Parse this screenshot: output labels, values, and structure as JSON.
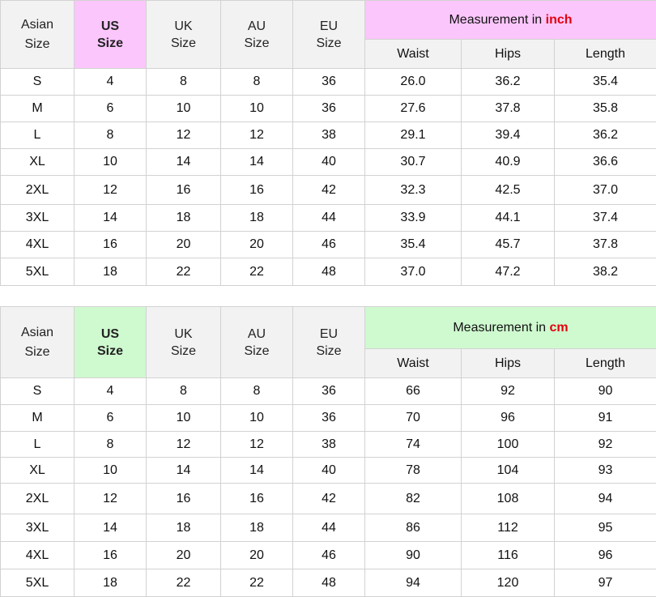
{
  "inch_table": {
    "headers": {
      "asian": [
        "Asian",
        "Size"
      ],
      "us": [
        "US",
        "Size"
      ],
      "uk": [
        "UK",
        "Size"
      ],
      "au": [
        "AU",
        "Size"
      ],
      "eu": [
        "EU",
        "Size"
      ],
      "measurement_prefix": "Measurement in",
      "measurement_unit": "inch",
      "waist": "Waist",
      "hips": "Hips",
      "length": "Length"
    },
    "rows": [
      [
        "S",
        "4",
        "8",
        "8",
        "36",
        "26.0",
        "36.2",
        "35.4"
      ],
      [
        "M",
        "6",
        "10",
        "10",
        "36",
        "27.6",
        "37.8",
        "35.8"
      ],
      [
        "L",
        "8",
        "12",
        "12",
        "38",
        "29.1",
        "39.4",
        "36.2"
      ],
      [
        "XL",
        "10",
        "14",
        "14",
        "40",
        "30.7",
        "40.9",
        "36.6"
      ],
      [
        "2XL",
        "12",
        "16",
        "16",
        "42",
        "32.3",
        "42.5",
        "37.0"
      ],
      [
        "3XL",
        "14",
        "18",
        "18",
        "44",
        "33.9",
        "44.1",
        "37.4"
      ],
      [
        "4XL",
        "16",
        "20",
        "20",
        "46",
        "35.4",
        "45.7",
        "37.8"
      ],
      [
        "5XL",
        "18",
        "22",
        "22",
        "48",
        "37.0",
        "47.2",
        "38.2"
      ]
    ]
  },
  "cm_table": {
    "headers": {
      "asian": [
        "Asian",
        "Size"
      ],
      "us": [
        "US",
        "Size"
      ],
      "uk": [
        "UK",
        "Size"
      ],
      "au": [
        "AU",
        "Size"
      ],
      "eu": [
        "EU",
        "Size"
      ],
      "measurement_prefix": "Measurement in",
      "measurement_unit": "cm",
      "waist": "Waist",
      "hips": "Hips",
      "length": "Length"
    },
    "rows": [
      [
        "S",
        "4",
        "8",
        "8",
        "36",
        "66",
        "92",
        "90"
      ],
      [
        "M",
        "6",
        "10",
        "10",
        "36",
        "70",
        "96",
        "91"
      ],
      [
        "L",
        "8",
        "12",
        "12",
        "38",
        "74",
        "100",
        "92"
      ],
      [
        "XL",
        "10",
        "14",
        "14",
        "40",
        "78",
        "104",
        "93"
      ],
      [
        "2XL",
        "12",
        "16",
        "16",
        "42",
        "82",
        "108",
        "94"
      ],
      [
        "3XL",
        "14",
        "18",
        "18",
        "44",
        "86",
        "112",
        "95"
      ],
      [
        "4XL",
        "16",
        "20",
        "20",
        "46",
        "90",
        "116",
        "96"
      ],
      [
        "5XL",
        "18",
        "22",
        "22",
        "48",
        "94",
        "120",
        "97"
      ]
    ]
  },
  "colors": {
    "inch_accent": "#fbc6fb",
    "cm_accent": "#cff9cf",
    "unit_text": "#e1000f",
    "header_bg": "#f2f2f2",
    "border": "#d2d2d2"
  }
}
